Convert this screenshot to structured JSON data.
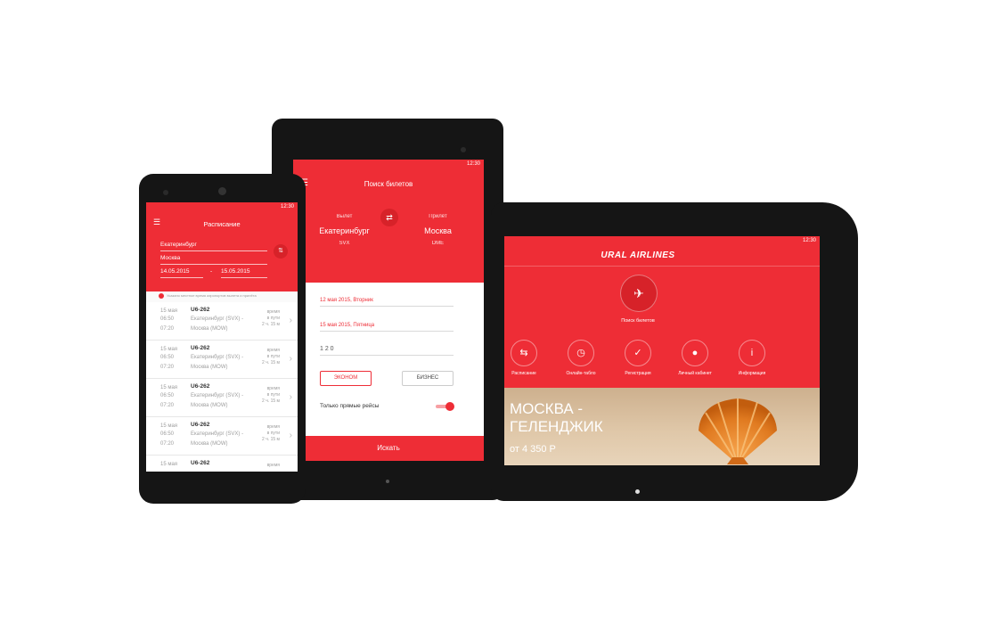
{
  "phone": {
    "status_time": "12:30",
    "title": "Расписание",
    "from": "Екатеринбург",
    "to": "Москва",
    "date_from": "14.05.2015",
    "date_to": "15.05.2015",
    "date_sep": "-",
    "notice": "Указано местное время аэропортов вылета и прилёта",
    "flights": [
      {
        "date": "15 мая",
        "dep": "06:50",
        "arr": "07:20",
        "code": "U6-262",
        "from": "Екатеринбург (SVX) -",
        "to": "Москва (MOW)",
        "dur_label": "время",
        "dur_label2": "в пути",
        "dur": "2 ч. 15 м"
      },
      {
        "date": "15 мая",
        "dep": "06:50",
        "arr": "07:20",
        "code": "U6-262",
        "from": "Екатеринбург (SVX) -",
        "to": "Москва (MOW)",
        "dur_label": "время",
        "dur_label2": "в пути",
        "dur": "2 ч. 15 м"
      },
      {
        "date": "15 мая",
        "dep": "06:50",
        "arr": "07:20",
        "code": "U6-262",
        "from": "Екатеринбург (SVX) -",
        "to": "Москва (MOW)",
        "dur_label": "время",
        "dur_label2": "в пути",
        "dur": "2 ч. 15 м"
      },
      {
        "date": "15 мая",
        "dep": "06:50",
        "arr": "07:20",
        "code": "U6-262",
        "from": "Екатеринбург (SVX) -",
        "to": "Москва (MOW)",
        "dur_label": "время",
        "dur_label2": "в пути",
        "dur": "2 ч. 15 м"
      }
    ],
    "partial_row": {
      "date": "15 мая",
      "code": "U6-262",
      "dur_label": "время"
    }
  },
  "tablet_small": {
    "status_time": "12:30",
    "title": "Поиск билетов",
    "departure_label": "Вылет",
    "departure_city": "Екатеринбург",
    "departure_code": "SVX",
    "arrival_label": "Прилёт",
    "arrival_city": "Москва",
    "arrival_code": "DME",
    "date_there": "12 мая 2015, Вторник",
    "date_back": "15 мая 2015, Пятница",
    "passengers": "1  2  0",
    "economy_label": "ЭКОНОМ",
    "business_label": "БИЗНЕС",
    "direct_label": "Только прямые рейсы",
    "search_label": "Искать"
  },
  "tablet_large": {
    "status_time": "12:30",
    "logo": "URAL AIRLINES",
    "search_label": "Поиск билетов",
    "nav": [
      {
        "label": "Расписание",
        "icon": "schedule-icon",
        "glyph": "⇆"
      },
      {
        "label": "Онлайн-табло",
        "icon": "clock-icon",
        "glyph": "◷"
      },
      {
        "label": "Регистрация",
        "icon": "check-icon",
        "glyph": "✓"
      },
      {
        "label": "Личный кабинет",
        "icon": "user-icon",
        "glyph": "●"
      },
      {
        "label": "Информация",
        "icon": "info-icon",
        "glyph": "i"
      }
    ],
    "promo_line1": "МОСКВА -",
    "promo_line2": "ГЕЛЕНДЖИК",
    "promo_price": "от 4 350 Р"
  },
  "colors": {
    "accent": "#ee2d36",
    "device": "#151515",
    "sand": "#d9bf9f"
  }
}
